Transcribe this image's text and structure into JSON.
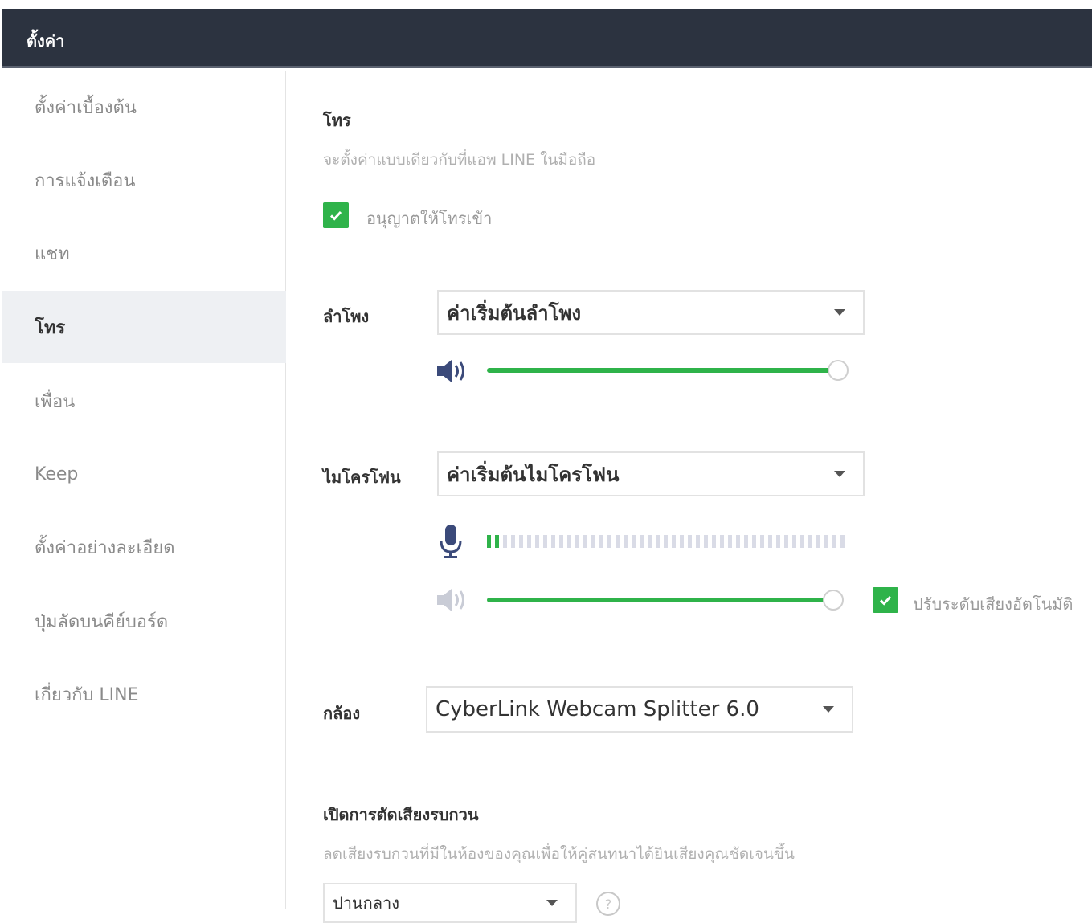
{
  "window": {
    "title": "ตั้งค่า"
  },
  "sidebar": {
    "items": [
      {
        "label": "ตั้งค่าเบื้องต้น"
      },
      {
        "label": "การแจ้งเตือน"
      },
      {
        "label": "แชท"
      },
      {
        "label": "โทร"
      },
      {
        "label": "เพื่อน"
      },
      {
        "label": "Keep"
      },
      {
        "label": "ตั้งค่าอย่างละเอียด"
      },
      {
        "label": "ปุ่มลัดบนคีย์บอร์ด"
      },
      {
        "label": "เกี่ยวกับ LINE"
      }
    ],
    "active_index": 3
  },
  "call": {
    "title": "โทร",
    "description": "จะตั้งค่าแบบเดียวกับที่แอพ LINE ในมือถือ",
    "allow_incoming": {
      "label": "อนุญาตให้โทรเข้า",
      "checked": true
    }
  },
  "speaker": {
    "label": "ลำโพง",
    "selected": "ค่าเริ่มต้นลำโพง",
    "volume": 1.0
  },
  "microphone": {
    "label": "ไมโครโฟน",
    "selected": "ค่าเริ่มต้นไมโครโฟน",
    "input_level": 0.04,
    "volume": 1.0,
    "auto_adjust": {
      "label": "ปรับระดับเสียงอัตโนมัติ",
      "checked": true
    }
  },
  "camera": {
    "label": "กล้อง",
    "selected": "CyberLink Webcam Splitter 6.0"
  },
  "noise": {
    "title": "เปิดการตัดเสียงรบกวน",
    "description": "ลดเสียงรบกวนที่มีในห้องของคุณเพื่อให้คู่สนทนาได้ยินเสียงคุณชัดเจนขึ้น",
    "selected": "ปานกลาง",
    "help": "?"
  },
  "colors": {
    "accent": "#2fb34a",
    "titlebar": "#2c3340"
  },
  "icons": [
    "speaker-icon",
    "microphone-icon",
    "checkmark-icon",
    "dropdown-arrow-icon",
    "help-icon"
  ]
}
